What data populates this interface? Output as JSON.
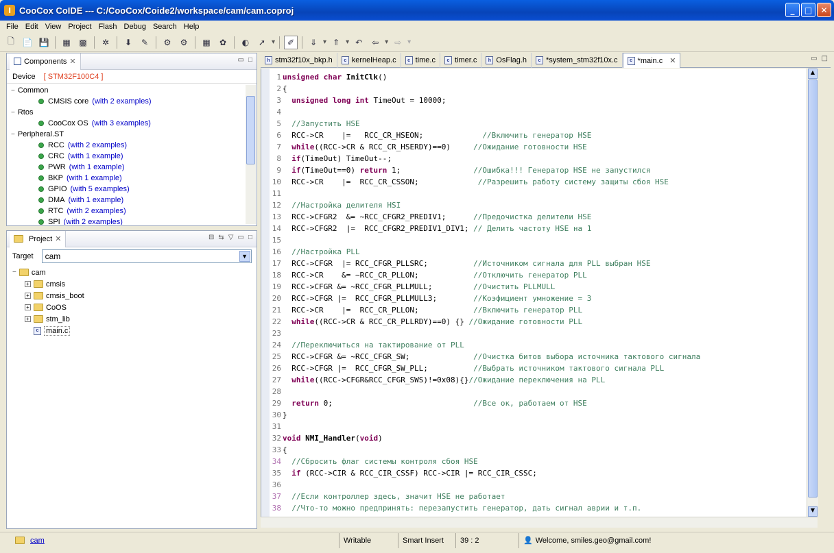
{
  "window": {
    "title": "CooCox CoIDE --- C:/CooCox/Coide2/workspace/cam/cam.coproj",
    "app_icon": "I"
  },
  "menu": [
    "File",
    "Edit",
    "View",
    "Project",
    "Flash",
    "Debug",
    "Search",
    "Help"
  ],
  "components": {
    "tab": "Components",
    "device_label": "Device",
    "device_value": "[ STM32F100C4 ]",
    "groups": [
      {
        "name": "Common",
        "items": [
          {
            "name": "CMSIS core",
            "examples": "(with 2 examples)"
          }
        ]
      },
      {
        "name": "Rtos",
        "items": [
          {
            "name": "CooCox OS",
            "examples": "(with 3 examples)"
          }
        ]
      },
      {
        "name": "Peripheral.ST",
        "items": [
          {
            "name": "RCC",
            "examples": "(with 2 examples)"
          },
          {
            "name": "CRC",
            "examples": "(with 1 example)"
          },
          {
            "name": "PWR",
            "examples": "(with 1 example)"
          },
          {
            "name": "BKP",
            "examples": "(with 1 example)"
          },
          {
            "name": "GPIO",
            "examples": "(with 5 examples)"
          },
          {
            "name": "DMA",
            "examples": "(with 1 example)"
          },
          {
            "name": "RTC",
            "examples": "(with 2 examples)"
          },
          {
            "name": "SPI",
            "examples": "(with 2 examples)"
          }
        ]
      }
    ]
  },
  "project": {
    "tab": "Project",
    "target_label": "Target",
    "target_value": "cam",
    "root": "cam",
    "folders": [
      "cmsis",
      "cmsis_boot",
      "CoOS",
      "stm_lib"
    ],
    "file": "main.c"
  },
  "editor_tabs": [
    "stm32f10x_bkp.h",
    "kernelHeap.c",
    "time.c",
    "timer.c",
    "OsFlag.h",
    "*system_stm32f10x.c",
    "*main.c"
  ],
  "code_lines": [
    {
      "n": "1",
      "t": "unsigned char InitClk()"
    },
    {
      "n": "2",
      "t": "{"
    },
    {
      "n": "3",
      "t": "  unsigned long int TimeOut = 10000;"
    },
    {
      "n": "4",
      "t": ""
    },
    {
      "n": "5",
      "t": "  //Запустить HSE"
    },
    {
      "n": "6",
      "t": "  RCC->CR    |=   RCC_CR_HSEON;             //Включить генератор HSE"
    },
    {
      "n": "7",
      "t": "  while((RCC->CR & RCC_CR_HSERDY)==0)     //Ожидание готовности HSE"
    },
    {
      "n": "8",
      "t": "  if(TimeOut) TimeOut--;"
    },
    {
      "n": "9",
      "t": "  if(TimeOut==0) return 1;                //Ошибка!!! Генератор HSE не запустился"
    },
    {
      "n": "10",
      "t": "  RCC->CR    |=  RCC_CR_CSSON;             //Разрешить работу систему защиты сбоя HSE"
    },
    {
      "n": "11",
      "t": ""
    },
    {
      "n": "12",
      "t": "  //Настройка делителя HSI"
    },
    {
      "n": "13",
      "t": "  RCC->CFGR2  &= ~RCC_CFGR2_PREDIV1;      //Предочистка делители HSE"
    },
    {
      "n": "14",
      "t": "  RCC->CFGR2  |=  RCC_CFGR2_PREDIV1_DIV1; // Делить частоту HSE на 1"
    },
    {
      "n": "15",
      "t": ""
    },
    {
      "n": "16",
      "t": "  //Настройка PLL"
    },
    {
      "n": "17",
      "t": "  RCC->CFGR  |= RCC_CFGR_PLLSRC;          //Источником сигнала для PLL выбран HSE"
    },
    {
      "n": "18",
      "t": "  RCC->CR    &= ~RCC_CR_PLLON;            //Отключить генератор PLL"
    },
    {
      "n": "19",
      "t": "  RCC->CFGR &= ~RCC_CFGR_PLLMULL;         //Очистить PLLMULL"
    },
    {
      "n": "20",
      "t": "  RCC->CFGR |=  RCC_CFGR_PLLMULL3;        //Коэфициент умножение = 3"
    },
    {
      "n": "21",
      "t": "  RCC->CR    |=  RCC_CR_PLLON;            //Включить генератор PLL"
    },
    {
      "n": "22",
      "t": "  while((RCC->CR & RCC_CR_PLLRDY)==0) {} //Ожидание готовности PLL"
    },
    {
      "n": "23",
      "t": ""
    },
    {
      "n": "24",
      "t": "  //Переключиться на тактирование от PLL"
    },
    {
      "n": "25",
      "t": "  RCC->CFGR &= ~RCC_CFGR_SW;              //Очистка битов выбора источника тактового сигнала"
    },
    {
      "n": "26",
      "t": "  RCC->CFGR |=  RCC_CFGR_SW_PLL;          //Выбрать источником тактового сигнала PLL"
    },
    {
      "n": "27",
      "t": "  while((RCC->CFGR&RCC_CFGR_SWS)!=0x08){}//Ожидание переключения на PLL"
    },
    {
      "n": "28",
      "t": ""
    },
    {
      "n": "29",
      "t": "  return 0;                               //Все ок, работаем от HSE"
    },
    {
      "n": "30",
      "t": "}"
    },
    {
      "n": "31",
      "t": ""
    },
    {
      "n": "32",
      "t": "void NMI_Handler(void)"
    },
    {
      "n": "33",
      "t": "{"
    },
    {
      "n": "34",
      "t": "  //Сбросить флаг системы контроля сбоя HSE"
    },
    {
      "n": "35",
      "t": "  if (RCC->CIR & RCC_CIR_CSSF) RCC->CIR |= RCC_CIR_CSSC;"
    },
    {
      "n": "36",
      "t": ""
    },
    {
      "n": "37",
      "t": "  //Если контроллер здесь, значит HSE не работает"
    },
    {
      "n": "38",
      "t": "  //Что-то можно предпринять: перезапустить генератор, дать сигнал аврии и т.п."
    }
  ],
  "status": {
    "project": "cam",
    "mode": "Writable",
    "insert": "Smart Insert",
    "position": "39 : 2",
    "welcome": "Welcome, smiles.geo@gmail.com!"
  },
  "colors": {
    "keyword": "#7f0055",
    "comment": "#3f7f5f",
    "accent": "#0a5fe0"
  }
}
